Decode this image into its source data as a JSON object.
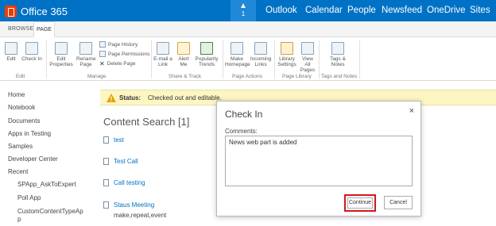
{
  "suite": {
    "brand": "Office 365",
    "notification_count": "1",
    "nav": [
      "Outlook",
      "Calendar",
      "People",
      "Newsfeed",
      "OneDrive",
      "Sites"
    ]
  },
  "ribbon": {
    "tabs": [
      "BROWSE",
      "PAGE"
    ],
    "active_tab": "PAGE",
    "buttons": {
      "edit": "Edit",
      "check_in": "Check In",
      "edit_properties": "Edit Properties",
      "rename_page": "Rename Page",
      "page_history": "Page History",
      "page_permissions": "Page Permissions",
      "delete_page": "Delete Page",
      "email_link": "E-mail a Link",
      "alert_me": "Alert Me",
      "popularity_trends": "Popularity Trends",
      "make_homepage": "Make Homepage",
      "incoming_links": "Incoming Links",
      "library_settings": "Library Settings",
      "view_all_pages": "View All Pages",
      "tags_notes": "Tags & Notes"
    },
    "groups": [
      "Edit",
      "Manage",
      "Share & Track",
      "Page Actions",
      "Page Library",
      "Tags and Notes"
    ]
  },
  "leftnav": {
    "items": [
      "Home",
      "Notebook",
      "Documents",
      "Apps in Testing",
      "Samples",
      "Developer Center",
      "Recent"
    ],
    "recent": [
      "SPApp_AskToExpert",
      "Poll App",
      "CustomContentTypeAp",
      "p"
    ]
  },
  "status": {
    "label": "Status:",
    "text": "Checked out and editable."
  },
  "content": {
    "title": "Content Search [1]",
    "results": [
      "test",
      "Test Call",
      "Call testing",
      "Staus Meeting"
    ],
    "last_result_sub": "make,repeat,event"
  },
  "dialog": {
    "title": "Check In",
    "close": "×",
    "comments_label": "Comments:",
    "comments_value": "News web part is added",
    "continue": "Continue",
    "cancel": "Cancel"
  },
  "colors": {
    "suitebar": "#0072c6",
    "status_bg": "#fdf6c3",
    "highlight_border": "#d4161e"
  }
}
